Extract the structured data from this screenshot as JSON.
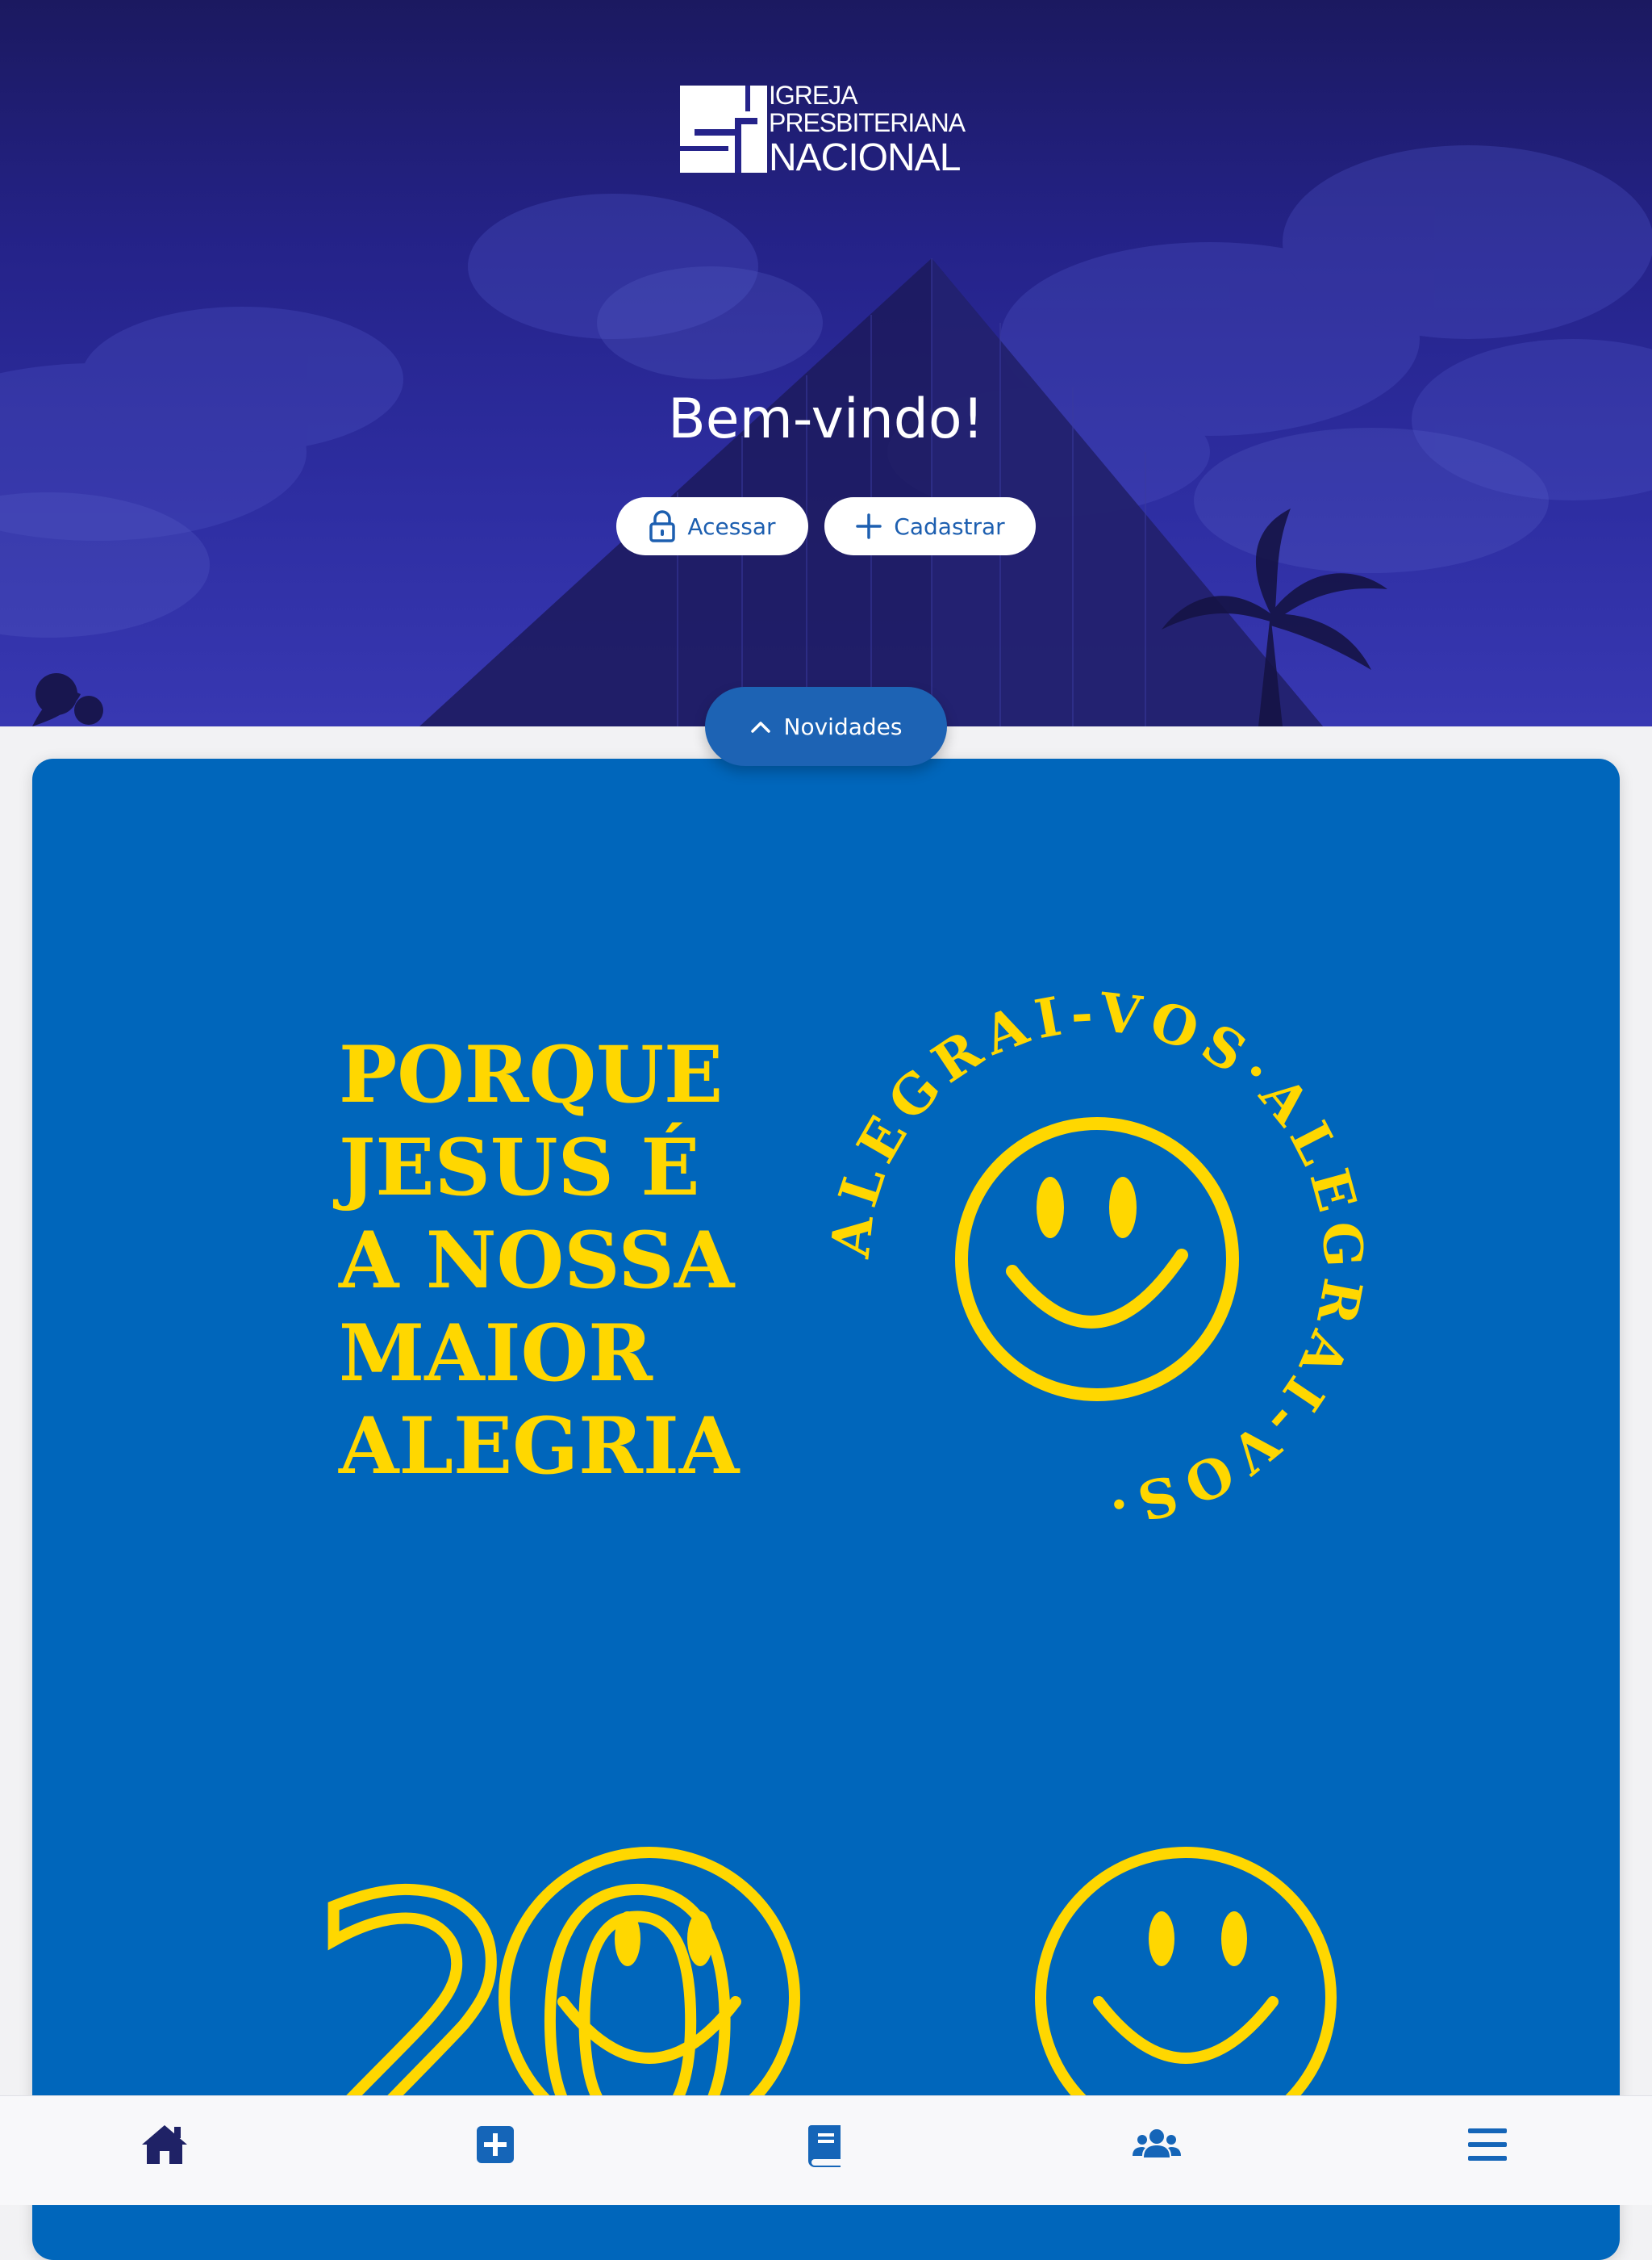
{
  "logo": {
    "line1": "IGREJA",
    "line2": "PRESBITERIANA",
    "line3": "NACIONAL"
  },
  "hero": {
    "title": "Bem-vindo!",
    "login_label": "Acessar",
    "signup_label": "Cadastrar"
  },
  "news_tab": {
    "label": "Novidades"
  },
  "banner": {
    "line1": "PORQUE",
    "line2": "JESUS É",
    "line3": "A NOSSA",
    "line4": "MAIOR",
    "line5": "ALEGRIA",
    "ring_text": "ALEGRAI-VOS·ALEGRAI-VOS·",
    "year_text": "20",
    "background": "#0066bb",
    "accent": "#ffd700"
  },
  "bottom_nav": [
    {
      "name": "home-icon",
      "active": true
    },
    {
      "name": "plus-square-icon"
    },
    {
      "name": "book-icon"
    },
    {
      "name": "users-icon"
    },
    {
      "name": "menu-icon"
    }
  ],
  "colors": {
    "primary": "#1d63b4",
    "nav_active": "#1f2266",
    "nav_icon": "#1565b8"
  }
}
